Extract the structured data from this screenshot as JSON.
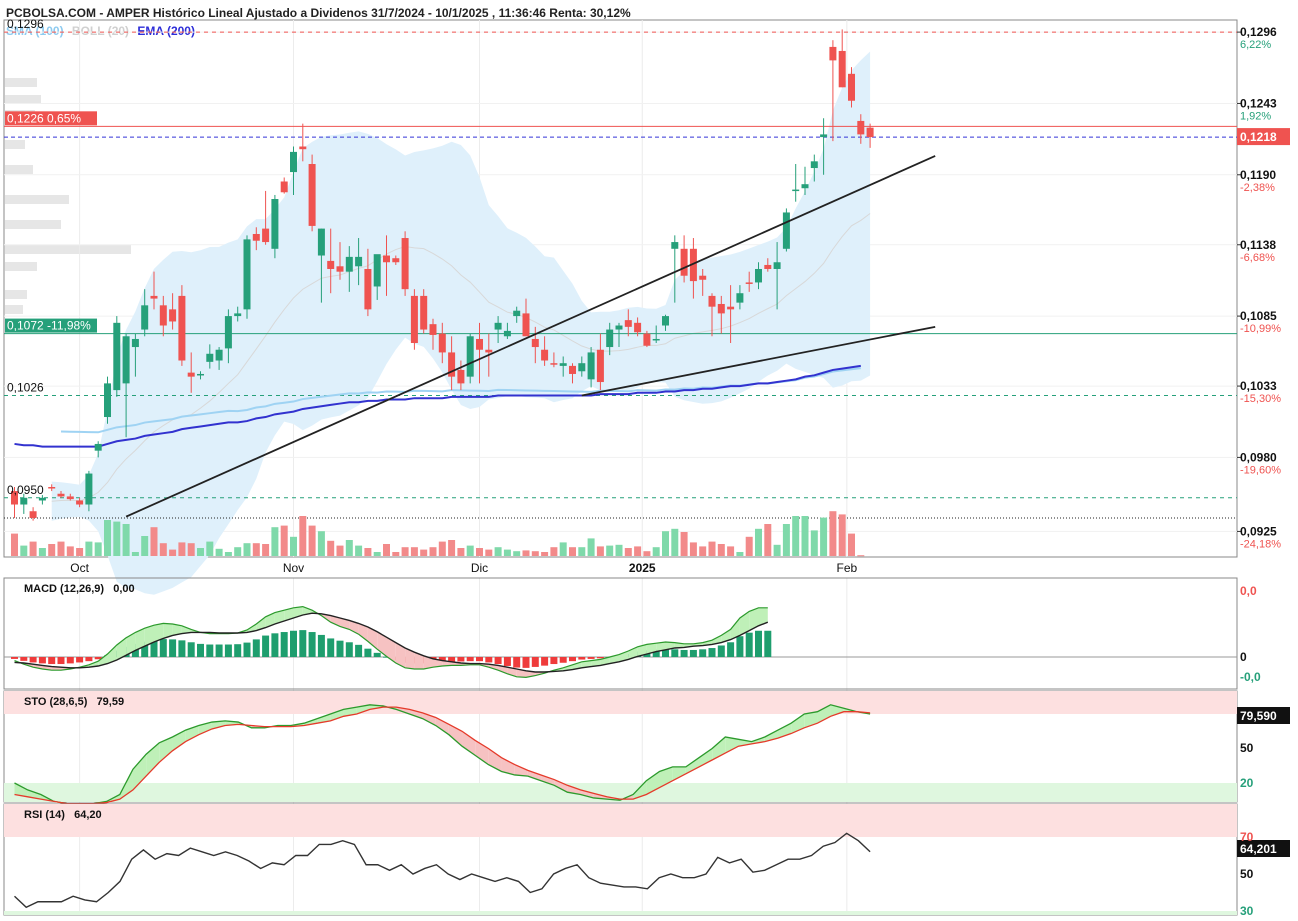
{
  "header": {
    "title": "PCBOLSA.COM - AMPER Histórico Lineal Ajustado a Dividenos 31/7/2024 - 10/1/2025 , 11:36:46 Renta: 30,12%",
    "indicators": [
      {
        "label": "SMA (100)",
        "color": "#8ecbf0"
      },
      {
        "label": "BOLL (20)",
        "color": "#d0d0d0"
      },
      {
        "label": "EMA (200)",
        "color": "#2e2ed8"
      }
    ]
  },
  "colors": {
    "up": "#26a07a",
    "down": "#ef5350",
    "upVol": "#7fd9aa",
    "downVol": "#f28a8a"
  },
  "price_axis": {
    "ticks": [
      {
        "v": 0.1296,
        "label": "0,1296",
        "pct": "6,22%",
        "pos": true
      },
      {
        "v": 0.1243,
        "label": "0,1243",
        "pct": "1,92%",
        "pos": true
      },
      {
        "v": 0.119,
        "label": "0,1190",
        "pct": "-2,38%",
        "pos": false
      },
      {
        "v": 0.1138,
        "label": "0,1138",
        "pct": "-6,68%",
        "pos": false
      },
      {
        "v": 0.1085,
        "label": "0,1085",
        "pct": "-10,99%",
        "pos": false
      },
      {
        "v": 0.1033,
        "label": "0,1033",
        "pct": "-15,30%",
        "pos": false
      },
      {
        "v": 0.098,
        "label": "0,0980",
        "pct": "-19,60%",
        "pos": false
      },
      {
        "v": 0.0925,
        "label": "0,0925",
        "pct": "-24,18%",
        "pos": false
      }
    ],
    "current_price_label": "0,1218"
  },
  "level_labels": [
    {
      "text": "0,1296",
      "value": 0.1296,
      "style": "plain"
    },
    {
      "text": "0,1226  0,65%",
      "value": 0.1226,
      "style": "red"
    },
    {
      "text": "0,1072  -11,98%",
      "value": 0.1072,
      "style": "green"
    },
    {
      "text": "0,1026",
      "value": 0.1026,
      "style": "plain"
    },
    {
      "text": "0,0950",
      "value": 0.095,
      "style": "plain"
    }
  ],
  "month_labels": [
    {
      "text": "Oct",
      "i": 7,
      "bold": false
    },
    {
      "text": "Nov",
      "i": 30,
      "bold": false
    },
    {
      "text": "Dic",
      "i": 50,
      "bold": false
    },
    {
      "text": "2025",
      "i": 67.5,
      "bold": true
    },
    {
      "text": "Feb",
      "i": 89.5,
      "bold": false
    }
  ],
  "panels": {
    "macd": {
      "label": "MACD (12,26,9)",
      "value": "0,00",
      "axis": [
        "0,0",
        "0",
        "-0,0"
      ]
    },
    "sto": {
      "label": "STO (28,6,5)",
      "value": "79,59",
      "badge": "79,590",
      "axis": [
        "50",
        "20"
      ]
    },
    "rsi": {
      "label": "RSI (14)",
      "value": "64,20",
      "badge": "64,201",
      "axis": [
        "70",
        "50",
        "30"
      ]
    }
  },
  "chart_data": {
    "type": "candlestick",
    "ylim": [
      0.0906,
      0.1305
    ],
    "ohlc": [
      [
        0.0955,
        0.0958,
        0.0935,
        0.0945
      ],
      [
        0.0945,
        0.0953,
        0.0938,
        0.095
      ],
      [
        0.094,
        0.0943,
        0.0933,
        0.0935
      ],
      [
        0.0948,
        0.0952,
        0.0945,
        0.095
      ],
      [
        0.0958,
        0.096,
        0.0955,
        0.0957
      ],
      [
        0.0953,
        0.0955,
        0.095,
        0.0951
      ],
      [
        0.0951,
        0.0953,
        0.0948,
        0.0949
      ],
      [
        0.0948,
        0.095,
        0.0943,
        0.0945
      ],
      [
        0.0945,
        0.097,
        0.094,
        0.0968
      ],
      [
        0.0985,
        0.0992,
        0.098,
        0.099
      ],
      [
        0.101,
        0.104,
        0.1005,
        0.1035
      ],
      [
        0.103,
        0.1085,
        0.1025,
        0.108
      ],
      [
        0.1035,
        0.1072,
        0.0995,
        0.107
      ],
      [
        0.1062,
        0.1072,
        0.104,
        0.1068
      ],
      [
        0.1075,
        0.1105,
        0.107,
        0.1093
      ],
      [
        0.11,
        0.1118,
        0.109,
        0.1098
      ],
      [
        0.1093,
        0.11,
        0.107,
        0.1078
      ],
      [
        0.109,
        0.1102,
        0.1075,
        0.1081
      ],
      [
        0.11,
        0.1108,
        0.1048,
        0.1052
      ],
      [
        0.1043,
        0.1058,
        0.1028,
        0.104
      ],
      [
        0.1041,
        0.1044,
        0.1038,
        0.1042
      ],
      [
        0.1051,
        0.1064,
        0.1046,
        0.1057
      ],
      [
        0.1052,
        0.1062,
        0.1045,
        0.106
      ],
      [
        0.1061,
        0.109,
        0.105,
        0.1085
      ],
      [
        0.1085,
        0.1092,
        0.1081,
        0.1087
      ],
      [
        0.109,
        0.1145,
        0.1083,
        0.1142
      ],
      [
        0.1146,
        0.1151,
        0.1134,
        0.1141
      ],
      [
        0.115,
        0.1178,
        0.1138,
        0.114
      ],
      [
        0.1135,
        0.1175,
        0.1128,
        0.1172
      ],
      [
        0.1185,
        0.1188,
        0.1176,
        0.1177
      ],
      [
        0.1192,
        0.1211,
        0.1175,
        0.1207
      ],
      [
        0.1211,
        0.1228,
        0.12,
        0.1209
      ],
      [
        0.1198,
        0.1205,
        0.1148,
        0.1152
      ],
      [
        0.113,
        0.115,
        0.1095,
        0.115
      ],
      [
        0.1126,
        0.115,
        0.1102,
        0.112
      ],
      [
        0.1122,
        0.114,
        0.1112,
        0.1118
      ],
      [
        0.1118,
        0.1137,
        0.1103,
        0.1129
      ],
      [
        0.1122,
        0.1143,
        0.1108,
        0.1129
      ],
      [
        0.112,
        0.1135,
        0.1085,
        0.109
      ],
      [
        0.1107,
        0.112,
        0.1097,
        0.1131
      ],
      [
        0.113,
        0.1145,
        0.11,
        0.1125
      ],
      [
        0.1128,
        0.113,
        0.1123,
        0.1125
      ],
      [
        0.1143,
        0.1148,
        0.11,
        0.1105
      ],
      [
        0.11,
        0.1105,
        0.106,
        0.1065
      ],
      [
        0.11,
        0.1105,
        0.1072,
        0.1075
      ],
      [
        0.1079,
        0.1083,
        0.106,
        0.1071
      ],
      [
        0.1072,
        0.108,
        0.105,
        0.1058
      ],
      [
        0.1058,
        0.107,
        0.103,
        0.104
      ],
      [
        0.1045,
        0.1052,
        0.103,
        0.1035
      ],
      [
        0.104,
        0.1072,
        0.1035,
        0.107
      ],
      [
        0.1068,
        0.108,
        0.1035,
        0.106
      ],
      [
        0.106,
        0.1072,
        0.104,
        0.1058
      ],
      [
        0.1075,
        0.1085,
        0.1065,
        0.108
      ],
      [
        0.107,
        0.108,
        0.1068,
        0.1074
      ],
      [
        0.1085,
        0.1092,
        0.108,
        0.1089
      ],
      [
        0.1087,
        0.1098,
        0.1072,
        0.107
      ],
      [
        0.1068,
        0.1077,
        0.105,
        0.1062
      ],
      [
        0.106,
        0.107,
        0.1048,
        0.1052
      ],
      [
        0.105,
        0.1058,
        0.1047,
        0.1049
      ],
      [
        0.1048,
        0.1055,
        0.104,
        0.105
      ],
      [
        0.1048,
        0.105,
        0.1035,
        0.1042
      ],
      [
        0.1044,
        0.1055,
        0.104,
        0.105
      ],
      [
        0.1038,
        0.1062,
        0.1032,
        0.1058
      ],
      [
        0.106,
        0.1072,
        0.103,
        0.1036
      ],
      [
        0.1062,
        0.108,
        0.1056,
        0.1075
      ],
      [
        0.1075,
        0.108,
        0.1062,
        0.1078
      ],
      [
        0.1082,
        0.109,
        0.107,
        0.1077
      ],
      [
        0.108,
        0.1084,
        0.107,
        0.1073
      ],
      [
        0.1072,
        0.1074,
        0.1062,
        0.1063
      ],
      [
        0.1068,
        0.1078,
        0.1065,
        0.1068
      ],
      [
        0.1078,
        0.1086,
        0.1074,
        0.1085
      ],
      [
        0.1135,
        0.1145,
        0.1095,
        0.114
      ],
      [
        0.1135,
        0.1145,
        0.111,
        0.1115
      ],
      [
        0.1135,
        0.1143,
        0.1098,
        0.1111
      ],
      [
        0.1115,
        0.112,
        0.11,
        0.1112
      ],
      [
        0.11,
        0.1102,
        0.107,
        0.1092
      ],
      [
        0.1094,
        0.11,
        0.1072,
        0.1087
      ],
      [
        0.1092,
        0.1108,
        0.1065,
        0.109
      ],
      [
        0.1095,
        0.1108,
        0.109,
        0.1102
      ],
      [
        0.111,
        0.1118,
        0.1103,
        0.1109
      ],
      [
        0.111,
        0.1125,
        0.1105,
        0.112
      ],
      [
        0.1123,
        0.1128,
        0.1118,
        0.112
      ],
      [
        0.112,
        0.114,
        0.109,
        0.1125
      ],
      [
        0.1135,
        0.1165,
        0.1133,
        0.1162
      ],
      [
        0.1178,
        0.1198,
        0.117,
        0.1179
      ],
      [
        0.118,
        0.1196,
        0.1175,
        0.1183
      ],
      [
        0.1195,
        0.1205,
        0.1185,
        0.12
      ],
      [
        0.1218,
        0.1232,
        0.119,
        0.122
      ],
      [
        0.1285,
        0.129,
        0.1215,
        0.1275
      ],
      [
        0.1282,
        0.1298,
        0.1255,
        0.1255
      ],
      [
        0.1265,
        0.127,
        0.124,
        0.1245
      ],
      [
        0.123,
        0.1235,
        0.1213,
        0.122
      ],
      [
        0.1225,
        0.1228,
        0.121,
        0.1218
      ]
    ],
    "volume": [
      0.28,
      0.13,
      0.18,
      0.1,
      0.15,
      0.18,
      0.12,
      0.1,
      0.18,
      0.17,
      0.45,
      0.43,
      0.4,
      0.05,
      0.25,
      0.36,
      0.16,
      0.08,
      0.17,
      0.16,
      0.1,
      0.18,
      0.09,
      0.05,
      0.11,
      0.16,
      0.16,
      0.15,
      0.36,
      0.38,
      0.24,
      0.5,
      0.38,
      0.31,
      0.19,
      0.13,
      0.2,
      0.13,
      0.1,
      0.05,
      0.15,
      0.05,
      0.11,
      0.11,
      0.08,
      0.11,
      0.18,
      0.2,
      0.1,
      0.13,
      0.1,
      0.08,
      0.11,
      0.08,
      0.06,
      0.07,
      0.06,
      0.05,
      0.11,
      0.17,
      0.11,
      0.11,
      0.22,
      0.12,
      0.13,
      0.14,
      0.1,
      0.12,
      0.06,
      0.11,
      0.31,
      0.34,
      0.3,
      0.17,
      0.12,
      0.18,
      0.15,
      0.12,
      0.05,
      0.24,
      0.34,
      0.4,
      0.14,
      0.4,
      0.5,
      0.5,
      0.32,
      0.48,
      0.56,
      0.52,
      0.28,
      0.01
    ],
    "ema200": [
      0.099,
      0.0989,
      0.0989,
      0.0988,
      0.0988,
      0.0988,
      0.0988,
      0.0988,
      0.0988,
      0.0988,
      0.099,
      0.0992,
      0.0993,
      0.0994,
      0.0996,
      0.0997,
      0.0998,
      0.0999,
      0.1001,
      0.1002,
      0.1003,
      0.1004,
      0.1005,
      0.1006,
      0.1006,
      0.1007,
      0.1009,
      0.101,
      0.1012,
      0.1013,
      0.1014,
      0.1016,
      0.1017,
      0.1018,
      0.1019,
      0.102,
      0.1021,
      0.1021,
      0.1022,
      0.1022,
      0.1023,
      0.1023,
      0.1023,
      0.1024,
      0.1024,
      0.1024,
      0.1024,
      0.1025,
      0.1025,
      0.1025,
      0.1025,
      0.1025,
      0.1026,
      0.1026,
      0.1026,
      0.1026,
      0.1026,
      0.1026,
      0.1026,
      0.1026,
      0.1026,
      0.1026,
      0.1026,
      0.1027,
      0.1027,
      0.1027,
      0.1027,
      0.1028,
      0.1028,
      0.1028,
      0.1029,
      0.1029,
      0.103,
      0.103,
      0.1031,
      0.1031,
      0.1032,
      0.1033,
      0.1033,
      0.1034,
      0.1035,
      0.1035,
      0.1036,
      0.1037,
      0.1038,
      0.104,
      0.1041,
      0.1043,
      0.1045,
      0.1046,
      0.1047,
      0.1048
    ],
    "sma100_visible_from": 5,
    "trendlines": [
      {
        "from": [
          12,
          0.0936
        ],
        "to": [
          99,
          0.1204
        ]
      },
      {
        "from": [
          61,
          0.1026
        ],
        "to": [
          99,
          0.1077
        ]
      }
    ],
    "hlines": [
      {
        "value": 0.1296,
        "style": "red-dashed"
      },
      {
        "value": 0.1226,
        "style": "red-solid"
      },
      {
        "value": 0.1218,
        "style": "blue-dashed"
      },
      {
        "value": 0.1072,
        "style": "green-solid"
      },
      {
        "value": 0.1026,
        "style": "green-dashed"
      },
      {
        "value": 0.095,
        "style": "green-dashed"
      },
      {
        "value": 0.0935,
        "style": "black-dotted"
      }
    ],
    "macd": {
      "range": [
        -1,
        1
      ],
      "macd": [
        -0.06,
        -0.12,
        -0.17,
        -0.2,
        -0.22,
        -0.22,
        -0.2,
        -0.17,
        -0.13,
        -0.07,
        0.05,
        0.2,
        0.32,
        0.41,
        0.48,
        0.53,
        0.56,
        0.55,
        0.52,
        0.46,
        0.41,
        0.39,
        0.39,
        0.39,
        0.4,
        0.45,
        0.55,
        0.67,
        0.74,
        0.78,
        0.82,
        0.84,
        0.78,
        0.69,
        0.58,
        0.51,
        0.46,
        0.38,
        0.26,
        0.13,
        0.01,
        -0.1,
        -0.18,
        -0.2,
        -0.2,
        -0.17,
        -0.15,
        -0.14,
        -0.14,
        -0.13,
        -0.13,
        -0.17,
        -0.22,
        -0.28,
        -0.33,
        -0.34,
        -0.31,
        -0.27,
        -0.22,
        -0.18,
        -0.13,
        -0.08,
        -0.06,
        -0.04,
        0.0,
        0.04,
        0.1,
        0.17,
        0.21,
        0.23,
        0.25,
        0.24,
        0.22,
        0.22,
        0.24,
        0.28,
        0.36,
        0.46,
        0.65,
        0.76,
        0.82,
        0.82
      ],
      "signal": [
        -0.09,
        -0.1,
        -0.12,
        -0.14,
        -0.16,
        -0.17,
        -0.18,
        -0.18,
        -0.17,
        -0.15,
        -0.11,
        -0.05,
        0.03,
        0.11,
        0.18,
        0.25,
        0.31,
        0.36,
        0.39,
        0.41,
        0.41,
        0.41,
        0.4,
        0.4,
        0.4,
        0.41,
        0.44,
        0.49,
        0.55,
        0.6,
        0.65,
        0.7,
        0.73,
        0.72,
        0.69,
        0.65,
        0.61,
        0.56,
        0.5,
        0.42,
        0.33,
        0.24,
        0.15,
        0.08,
        0.02,
        -0.03,
        -0.06,
        -0.08,
        -0.1,
        -0.11,
        -0.11,
        -0.12,
        -0.14,
        -0.17,
        -0.2,
        -0.23,
        -0.25,
        -0.25,
        -0.24,
        -0.23,
        -0.21,
        -0.18,
        -0.16,
        -0.14,
        -0.11,
        -0.08,
        -0.04,
        0.01,
        0.05,
        0.09,
        0.12,
        0.15,
        0.16,
        0.18,
        0.19,
        0.21,
        0.24,
        0.29,
        0.36,
        0.44,
        0.52,
        0.58
      ],
      "from_bar": 11
    },
    "sto": {
      "k": [
        20,
        14,
        10,
        4,
        2,
        2,
        2,
        4,
        10,
        32,
        45,
        55,
        60,
        66,
        70,
        73,
        74,
        73,
        68,
        68,
        70,
        70,
        72,
        76,
        80,
        84,
        86,
        88,
        87,
        84,
        80,
        76,
        70,
        62,
        52,
        44,
        36,
        30,
        27,
        26,
        22,
        18,
        12,
        10,
        7,
        6,
        5,
        10,
        22,
        30,
        34,
        34,
        42,
        50,
        60,
        58,
        56,
        60,
        66,
        72,
        80,
        82,
        88,
        85,
        82,
        80
      ],
      "d": [
        10,
        8,
        6,
        4,
        2,
        2,
        2,
        3,
        6,
        14,
        26,
        38,
        48,
        56,
        62,
        67,
        70,
        71,
        70,
        69,
        69,
        69,
        70,
        72,
        74,
        78,
        80,
        84,
        86,
        86,
        84,
        81,
        77,
        71,
        65,
        57,
        50,
        42,
        36,
        31,
        27,
        23,
        18,
        14,
        11,
        8,
        6,
        6,
        10,
        16,
        22,
        28,
        34,
        40,
        46,
        52,
        54,
        56,
        59,
        63,
        68,
        72,
        78,
        82,
        82,
        81
      ],
      "from_bar": 27
    },
    "rsi": [
      38,
      32,
      35,
      35,
      35,
      38,
      36,
      35,
      40,
      46,
      58,
      63,
      58,
      61,
      60,
      64,
      62,
      60,
      62,
      60,
      57,
      53,
      56,
      55,
      60,
      60,
      66,
      66,
      68,
      66,
      55,
      55,
      52,
      55,
      50,
      53,
      55,
      50,
      47,
      50,
      48,
      46,
      48,
      46,
      40,
      42,
      50,
      53,
      55,
      48,
      45,
      44,
      43,
      43,
      42,
      48,
      50,
      48,
      48,
      50,
      59,
      56,
      58,
      51,
      52,
      55,
      58,
      58,
      60,
      65,
      67,
      72,
      68,
      62
    ],
    "rsi_from_bar": 28
  }
}
